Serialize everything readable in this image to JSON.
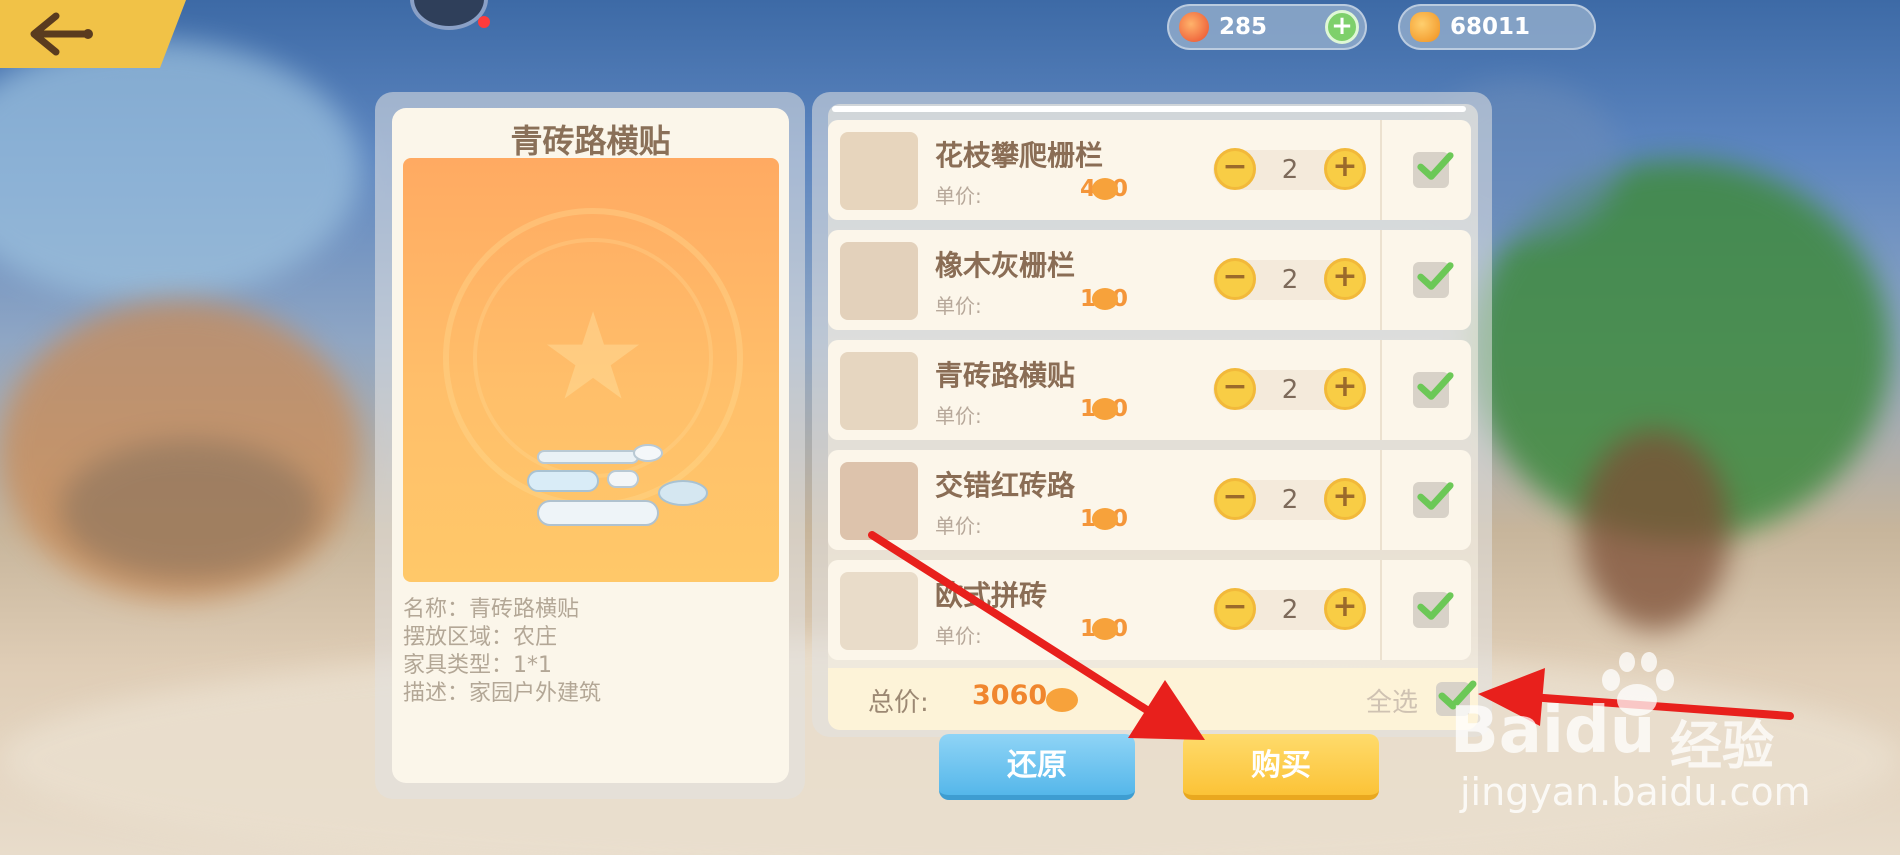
{
  "topbar": {
    "back_icon": "back-arrow-icon",
    "currency_1": {
      "icon": "peach-icon",
      "value": "285"
    },
    "currency_2": {
      "icon": "bean-coin-icon",
      "value": "68011"
    }
  },
  "detail": {
    "title": "青砖路横贴",
    "info": [
      "名称：青砖路横贴",
      "摆放区域：农庄",
      "家具类型：1*1",
      "描述：家园户外建筑"
    ]
  },
  "cart": {
    "unit_label": "单价:",
    "items": [
      {
        "name": "花枝攀爬栅栏",
        "price": "460",
        "qty": "2",
        "checked": true
      },
      {
        "name": "橡木灰栅栏",
        "price": "190",
        "qty": "2",
        "checked": true
      },
      {
        "name": "青砖路横贴",
        "price": "110",
        "qty": "2",
        "checked": true
      },
      {
        "name": "交错红砖路",
        "price": "110",
        "qty": "2",
        "checked": true
      },
      {
        "name": "欧式拼砖",
        "price": "110",
        "qty": "2",
        "checked": true
      }
    ],
    "total_label": "总价:",
    "total_value": "3060",
    "select_all_label": "全选"
  },
  "buttons": {
    "reset": "还原",
    "buy": "购买"
  },
  "watermark": {
    "logo_left": "Bai",
    "logo_mid": "du",
    "logo_right": "经验",
    "url": "jingyan.baidu.com"
  },
  "colors": {
    "accent_yellow": "#f8cd45",
    "price_orange": "#f4963a",
    "check_green": "#72c95a",
    "reset_blue": "#55b7ea",
    "arrow_red": "#e8201c"
  }
}
